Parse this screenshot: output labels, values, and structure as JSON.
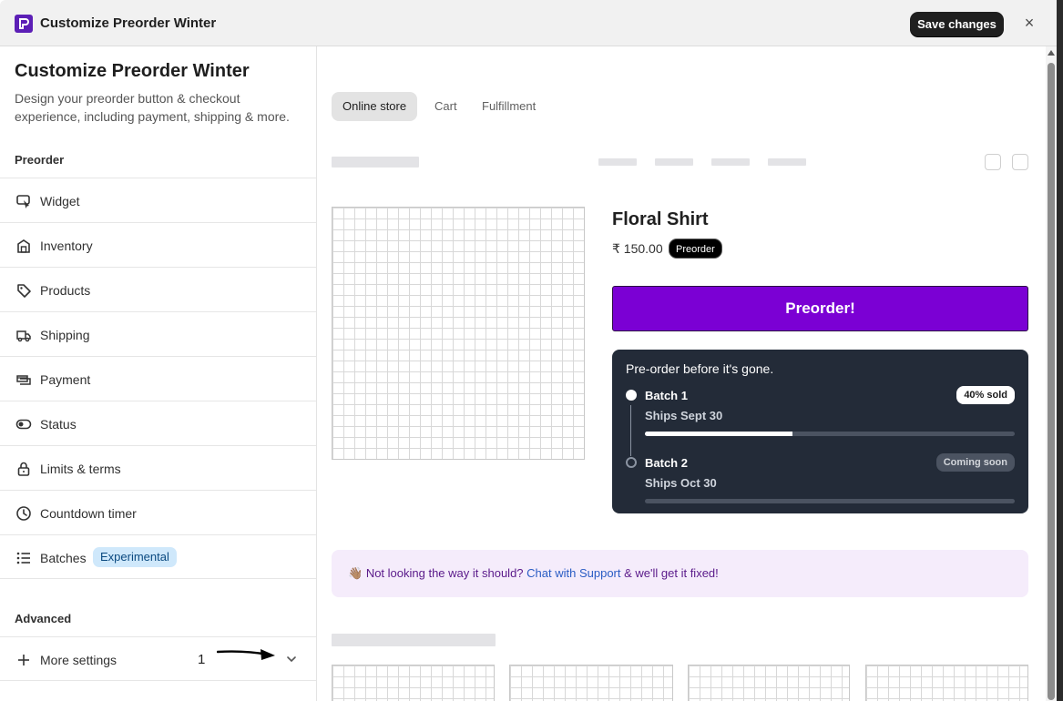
{
  "header": {
    "title": "Customize Preorder Winter",
    "save_label": "Save changes",
    "close_glyph": "×"
  },
  "sidebar": {
    "title": "Customize Preorder Winter",
    "description": "Design your preorder button & checkout experience, including payment, shipping & more.",
    "section_preorder": "Preorder",
    "items": [
      {
        "label": "Widget",
        "icon": "widget-cursor-icon"
      },
      {
        "label": "Inventory",
        "icon": "warehouse-icon"
      },
      {
        "label": "Products",
        "icon": "tag-icon"
      },
      {
        "label": "Shipping",
        "icon": "delivery-truck-icon"
      },
      {
        "label": "Payment",
        "icon": "payment-card-icon"
      },
      {
        "label": "Status",
        "icon": "toggle-icon"
      },
      {
        "label": "Limits & terms",
        "icon": "lock-icon"
      },
      {
        "label": "Countdown timer",
        "icon": "clock-icon"
      },
      {
        "label": "Batches",
        "icon": "list-icon",
        "badge": "Experimental"
      }
    ],
    "section_advanced": "Advanced",
    "more_settings": {
      "label": "More settings",
      "annotation_number": "1",
      "icon": "plus-icon"
    }
  },
  "preview": {
    "tabs": [
      "Online store",
      "Cart",
      "Fulfillment"
    ],
    "active_tab": "Online store",
    "product": {
      "title": "Floral Shirt",
      "price": "₹ 150.00",
      "badge": "Preorder",
      "button_label": "Preorder!",
      "button_color": "#7b00d4"
    },
    "batches": {
      "heading": "Pre-order before it's gone.",
      "items": [
        {
          "name": "Batch 1",
          "ships": "Ships Sept 30",
          "status": "40% sold",
          "progress": 0.4
        },
        {
          "name": "Batch 2",
          "ships": "Ships Oct 30",
          "status": "Coming soon",
          "progress": 0
        }
      ]
    },
    "support": {
      "emoji": "👋🏽",
      "text_before": "Not looking the way it should?",
      "link": "Chat with Support",
      "text_after": "& we'll get it fixed!"
    }
  }
}
